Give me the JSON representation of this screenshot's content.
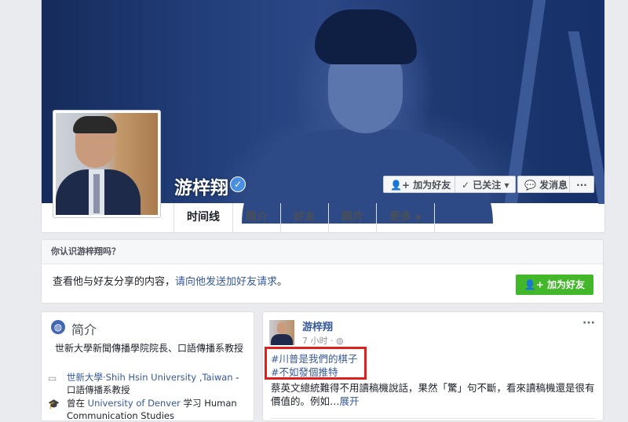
{
  "profile": {
    "name": "游梓翔",
    "verified_mark": "✓",
    "buttons": {
      "add_friend": "加为好友",
      "following": "已关注",
      "message": "发消息",
      "more": "···"
    },
    "tabs": [
      "时间线",
      "简介",
      "好友",
      "照片",
      "更多"
    ]
  },
  "know_card": {
    "header": "你认识游梓翔吗？",
    "body_prefix": "查看他与好友分享的内容，",
    "body_link": "请向他发送加好友请求",
    "body_suffix": "。",
    "button": "加为好友"
  },
  "intro": {
    "title": "简介",
    "bio": "世新大學新聞傳播學院院長、口語傳播系教授",
    "work": {
      "link": "世新大學‧Shih Hsin University ,Taiwan",
      "rest": " - 口語傳播系教授"
    },
    "education": {
      "prefix": "曾在 ",
      "link": "University of Denver",
      "rest": " 学习 Human Communication Studies"
    }
  },
  "post": {
    "author": "游梓翔",
    "time": "7 小时 · ",
    "more": "···",
    "tags": [
      "#川普是我們的棋子",
      "#不如發個推特"
    ],
    "text": "蔡英文總統難得不用讀稿機說話，果然「驚」句不斷，看來讀稿機還是很有價值的。例如…",
    "expand": "展开"
  },
  "colors": {
    "link": "#365899",
    "green": "#42b72a",
    "highlight": "#e0201c",
    "background": "#e9ebee"
  },
  "icons": [
    "verified-icon",
    "add-friend-icon",
    "check-icon",
    "messenger-icon",
    "globe-icon",
    "briefcase-icon",
    "graduation-cap-icon",
    "public-globe-icon",
    "caret-down-icon"
  ]
}
